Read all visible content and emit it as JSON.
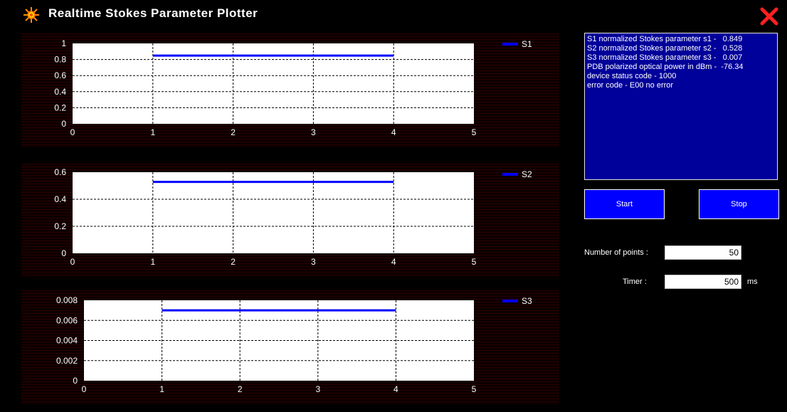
{
  "app": {
    "title": "Realtime Stokes Parameter Plotter",
    "icon": "sun-icon",
    "close_icon": "close-icon"
  },
  "info": {
    "lines": [
      "S1 normalized Stokes parameter s1 -   0.849",
      "S2 normalized Stokes parameter s2 -   0.528",
      "S3 normalized Stokes parameter s3 -   0.007",
      "PDB polarized optical power in dBm -  -76.34",
      "device status code - 1000",
      "error code - E00 no error"
    ]
  },
  "controls": {
    "start_label": "Start",
    "stop_label": "Stop",
    "points_label": "Number of points :",
    "points_value": "50",
    "timer_label": "Timer :",
    "timer_value": "500",
    "timer_unit": "ms"
  },
  "colors": {
    "series": "#0000ff",
    "info_bg": "#00009a",
    "button_bg": "#0000ff",
    "close": "#ff2020"
  },
  "chart_data": [
    {
      "type": "line",
      "series": [
        {
          "name": "S1",
          "x": [
            1,
            2,
            3,
            4
          ],
          "y": [
            0.849,
            0.849,
            0.849,
            0.849
          ]
        }
      ],
      "xlim": [
        0,
        5
      ],
      "ylim": [
        0,
        1
      ],
      "x_ticks": [
        "0",
        "1",
        "2",
        "3",
        "4",
        "5"
      ],
      "y_ticks": [
        "0",
        "0.2",
        "0.4",
        "0.6",
        "0.8",
        "1"
      ],
      "grid": true,
      "legend": "top-right"
    },
    {
      "type": "line",
      "series": [
        {
          "name": "S2",
          "x": [
            1,
            2,
            3,
            4
          ],
          "y": [
            0.528,
            0.528,
            0.528,
            0.528
          ]
        }
      ],
      "xlim": [
        0,
        5
      ],
      "ylim": [
        0,
        0.6
      ],
      "x_ticks": [
        "0",
        "1",
        "2",
        "3",
        "4",
        "5"
      ],
      "y_ticks": [
        "0",
        "0.2",
        "0.4",
        "0.6"
      ],
      "grid": true,
      "legend": "top-right"
    },
    {
      "type": "line",
      "series": [
        {
          "name": "S3",
          "x": [
            1,
            2,
            3,
            4
          ],
          "y": [
            0.007,
            0.007,
            0.007,
            0.007
          ]
        }
      ],
      "xlim": [
        0,
        5
      ],
      "ylim": [
        0,
        0.008
      ],
      "x_ticks": [
        "0",
        "1",
        "2",
        "3",
        "4",
        "5"
      ],
      "y_ticks": [
        "0",
        "0.002",
        "0.004",
        "0.006",
        "0.008"
      ],
      "grid": true,
      "legend": "top-right"
    }
  ]
}
